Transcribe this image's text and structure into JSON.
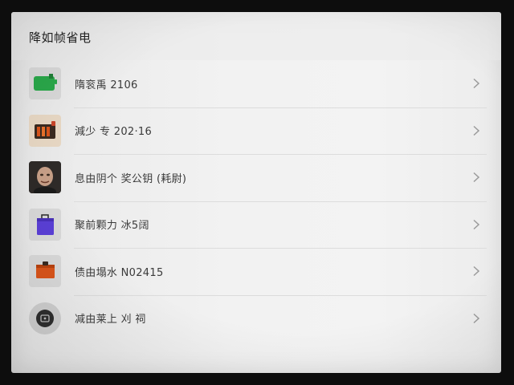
{
  "page": {
    "title": "降如帧省电"
  },
  "items": [
    {
      "label": "隋衮禹 2106",
      "icon": "green-battery-icon"
    },
    {
      "label": "減少 专 202·16",
      "icon": "heater-icon"
    },
    {
      "label": "息由阴个 奖公钥 (耗尉)",
      "icon": "face-avatar-icon"
    },
    {
      "label": "聚前颗力 冰5阔",
      "icon": "purple-shopping-bag-icon"
    },
    {
      "label": "债由塌水 N02415",
      "icon": "orange-box-icon"
    },
    {
      "label": "减由莱上 刈 祠",
      "icon": "gray-circle-button-icon"
    }
  ],
  "colors": {
    "green": "#2aa84a",
    "orange": "#d9541a",
    "purple": "#5a3fd6"
  }
}
